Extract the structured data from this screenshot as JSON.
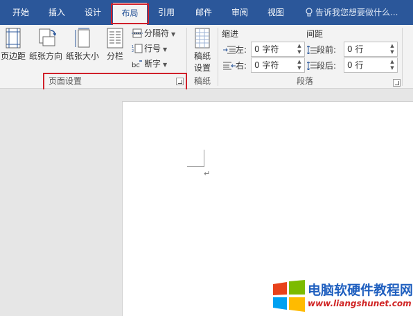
{
  "tabs": [
    {
      "label": "开始"
    },
    {
      "label": "插入"
    },
    {
      "label": "设计"
    },
    {
      "label": "布局",
      "active": true
    },
    {
      "label": "引用"
    },
    {
      "label": "邮件"
    },
    {
      "label": "审阅"
    },
    {
      "label": "视图"
    }
  ],
  "tell_me": {
    "text": "告诉我您想要做什么..."
  },
  "ribbon": {
    "page_setup": {
      "margins_label": "页边距",
      "orientation_label": "纸张方向",
      "size_label": "纸张大小",
      "columns_label": "分栏",
      "breaks_label": "分隔符",
      "line_numbers_label": "行号",
      "hyphenation_label": "断字",
      "group_label": "页面设置"
    },
    "draft_paper": {
      "button_label_line1": "稿纸",
      "button_label_line2": "设置",
      "group_label": "稿纸"
    },
    "paragraph": {
      "indent_header": "缩进",
      "spacing_header": "间距",
      "left_label": "左:",
      "left_value": "0 字符",
      "right_label": "右:",
      "right_value": "0 字符",
      "before_label": "段前:",
      "before_value": "0 行",
      "after_label": "段后:",
      "after_value": "0 行",
      "group_label": "段落"
    }
  },
  "document": {
    "paragraph_mark": "↵"
  },
  "watermark": {
    "title": "电脑软硬件教程网",
    "url": "www.liangshunet.com"
  },
  "colors": {
    "ribbon_blue": "#2b579a",
    "highlight_red": "#d0202a",
    "watermark_blue": "#1f5fbf",
    "watermark_red": "#d02424"
  }
}
